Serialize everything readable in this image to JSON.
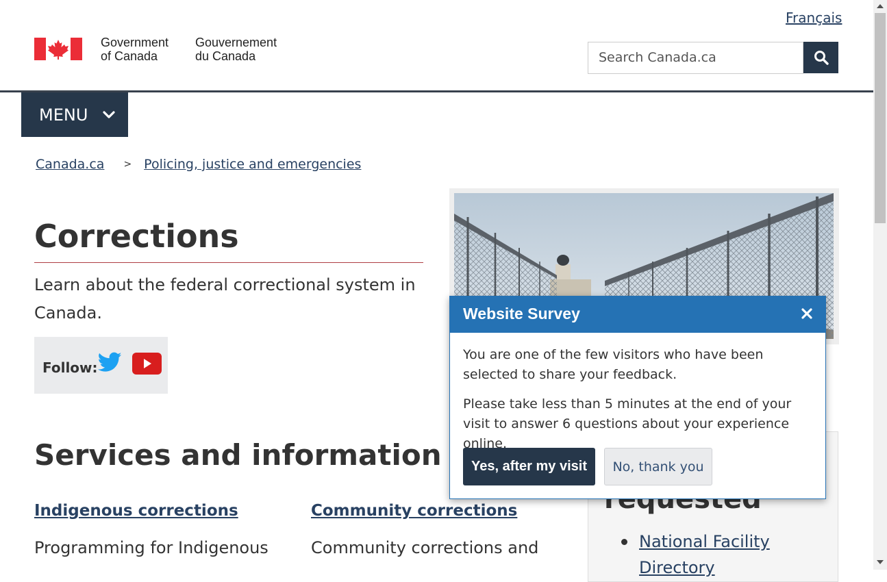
{
  "header": {
    "language_link": "Français",
    "signature_en_line1": "Government",
    "signature_en_line2": "of Canada",
    "signature_fr_line1": "Gouvernement",
    "signature_fr_line2": "du Canada",
    "search_placeholder": "Search Canada.ca",
    "search_icon": "search-icon",
    "menu_label": "MENU",
    "menu_icon": "chevron-down-icon"
  },
  "breadcrumb": {
    "items": [
      "Canada.ca",
      "Policing, justice and emergencies"
    ],
    "separator": ">"
  },
  "main": {
    "title": "Corrections",
    "intro": "Learn about the federal correctional system in Canada.",
    "follow_label": "Follow:",
    "social_icons": [
      "twitter-icon",
      "youtube-icon"
    ]
  },
  "services": {
    "heading": "Services and information",
    "items": [
      {
        "title": "Indigenous corrections",
        "desc": "Programming for Indigenous"
      },
      {
        "title": "Community corrections",
        "desc": "Community corrections and"
      }
    ]
  },
  "most_requested": {
    "heading_visible": "requested",
    "items": [
      "National Facility Directory"
    ]
  },
  "survey": {
    "title": "Website Survey",
    "p1": "You are one of the few visitors who have been selected to share your feedback.",
    "p2": "Please take less than 5 minutes at the end of your visit to answer 6 questions about your experience online.",
    "yes_label": "Yes, after my visit",
    "no_label": "No, thank you",
    "close_icon": "close-icon"
  },
  "colors": {
    "navy": "#26374a",
    "link": "#284162",
    "survey_blue": "#2572b4",
    "title_rule": "#af3c43",
    "flag_red": "#eb2d37"
  }
}
